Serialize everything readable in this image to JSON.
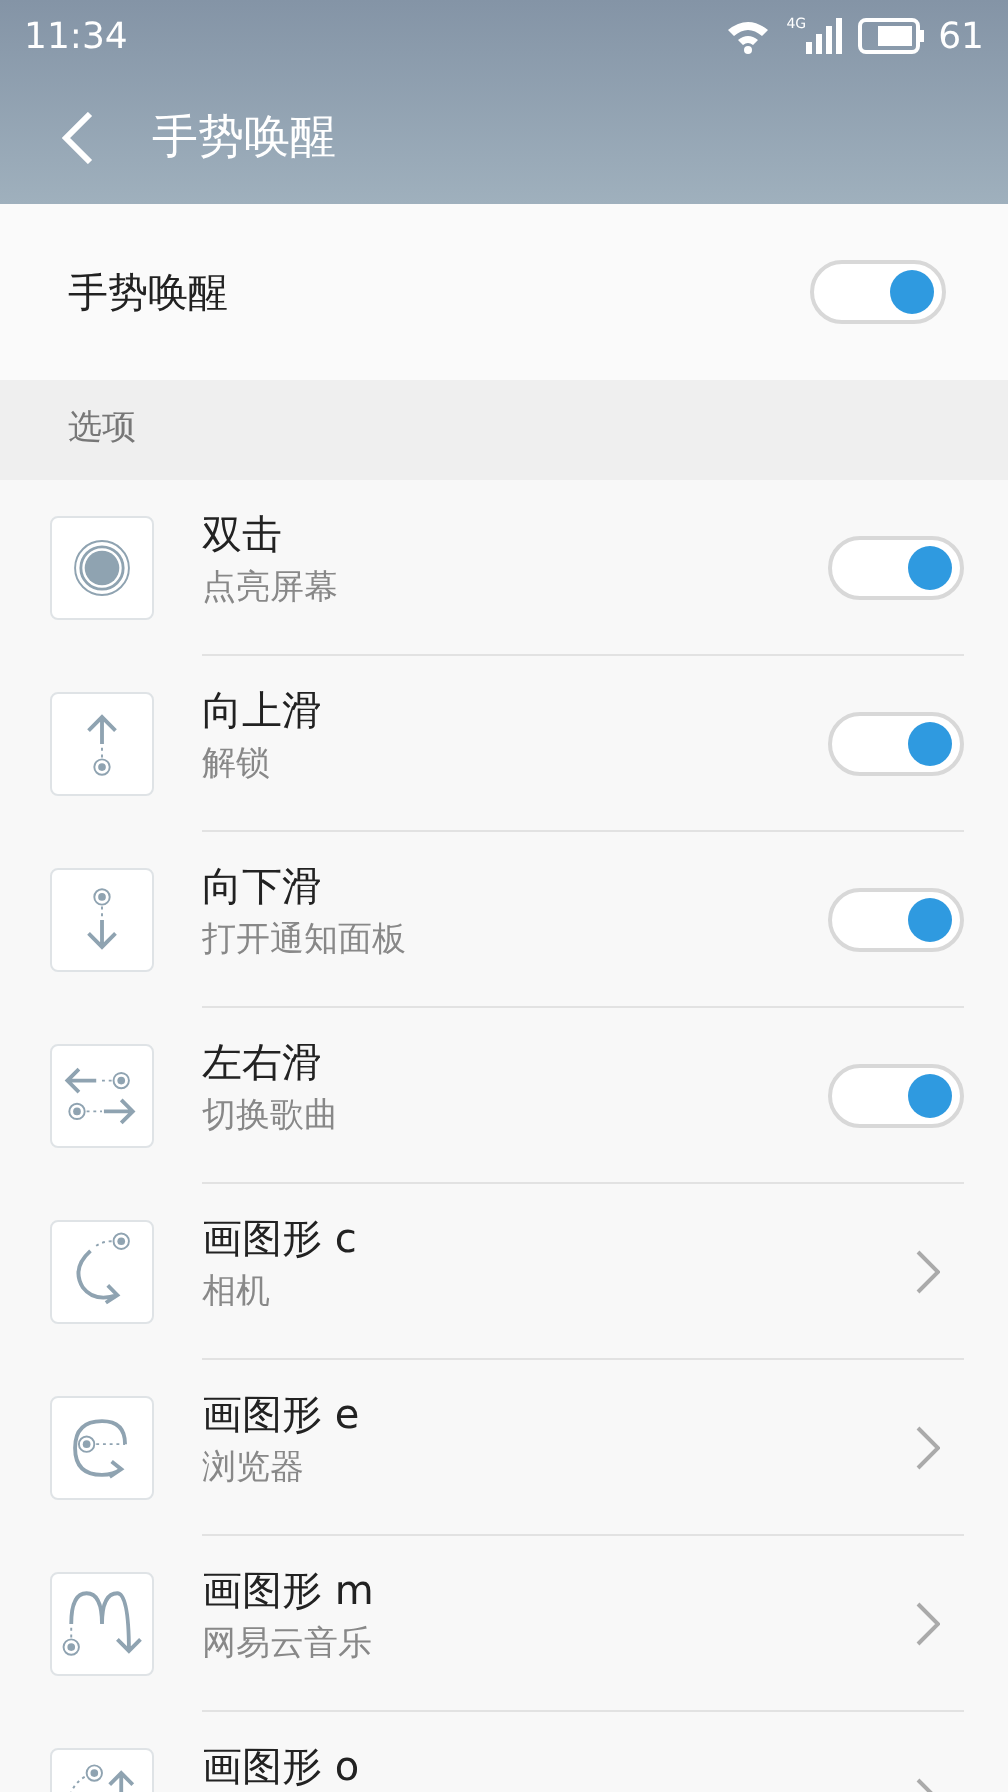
{
  "status_bar": {
    "time": "11:34",
    "network": "4G",
    "battery": "61"
  },
  "header": {
    "title": "手势唤醒"
  },
  "master": {
    "label": "手势唤醒",
    "on": true
  },
  "section": {
    "title": "选项"
  },
  "rows": [
    {
      "kind": "toggle",
      "title": "双击",
      "subtitle": "点亮屏幕",
      "on": true
    },
    {
      "kind": "toggle",
      "title": "向上滑",
      "subtitle": "解锁",
      "on": true
    },
    {
      "kind": "toggle",
      "title": "向下滑",
      "subtitle": "打开通知面板",
      "on": true
    },
    {
      "kind": "toggle",
      "title": "左右滑",
      "subtitle": "切换歌曲",
      "on": true
    },
    {
      "kind": "link",
      "title": "画图形 c",
      "subtitle": "相机"
    },
    {
      "kind": "link",
      "title": "画图形 e",
      "subtitle": "浏览器"
    },
    {
      "kind": "link",
      "title": "画图形 m",
      "subtitle": "网易云音乐"
    },
    {
      "kind": "link",
      "title": "画图形 o"
    }
  ]
}
